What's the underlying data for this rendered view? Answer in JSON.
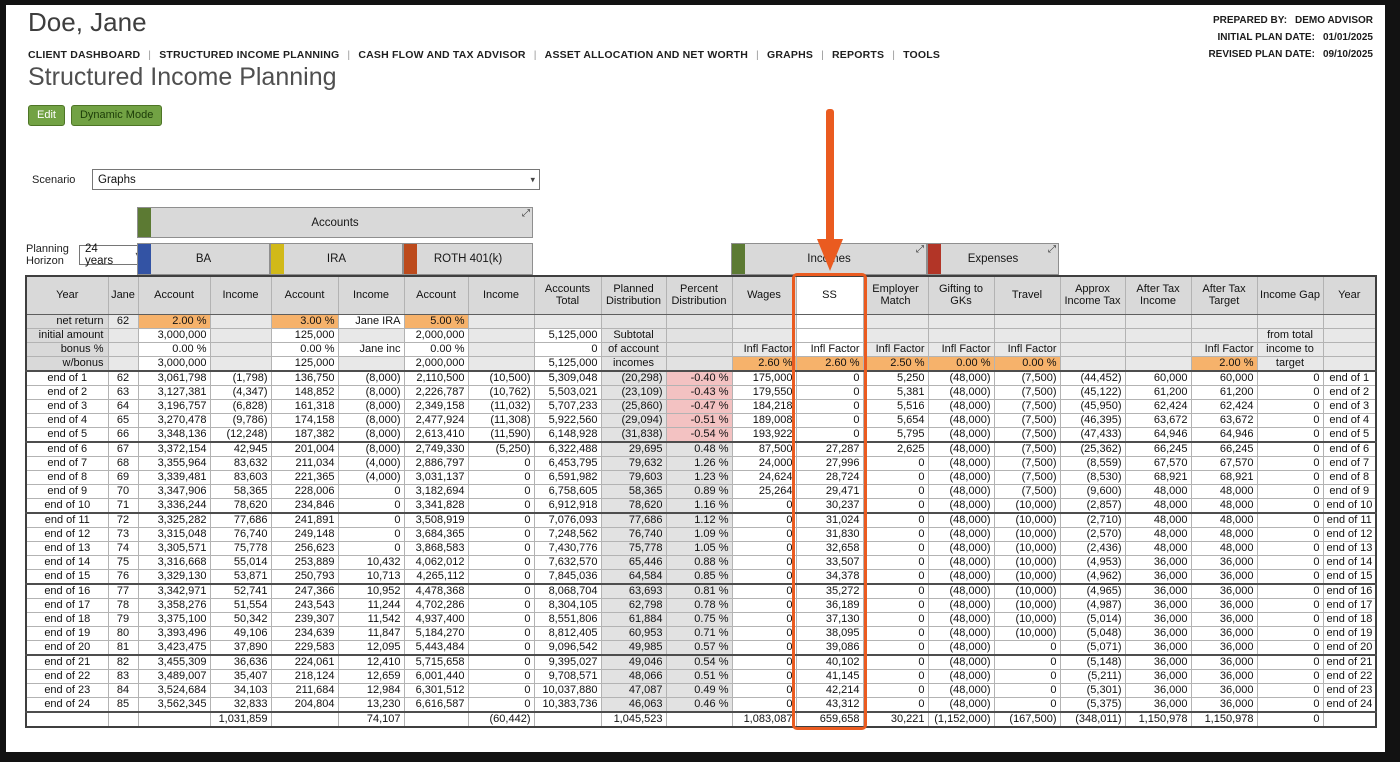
{
  "header": {
    "client_name": "Doe, Jane",
    "prepared_by_label": "PREPARED BY:",
    "prepared_by": "DEMO ADVISOR",
    "initial_plan_date_label": "INITIAL PLAN DATE:",
    "initial_plan_date": "01/01/2025",
    "revised_plan_date_label": "REVISED PLAN DATE:",
    "revised_plan_date": "09/10/2025"
  },
  "nav": {
    "items": [
      "CLIENT DASHBOARD",
      "STRUCTURED INCOME PLANNING",
      "CASH FLOW AND TAX ADVISOR",
      "ASSET ALLOCATION AND NET WORTH",
      "GRAPHS",
      "REPORTS",
      "TOOLS"
    ]
  },
  "page": {
    "title": "Structured Income Planning",
    "buttons": {
      "edit": "Edit",
      "dynamic_mode": "Dynamic Mode"
    },
    "scenario_label": "Scenario",
    "scenario_value": "Graphs",
    "planning_horizon_label": "Planning Horizon",
    "planning_horizon_value": "24 years"
  },
  "colors": {
    "accent_orange": "#ea5b20",
    "button_green": "#72a244",
    "group_green": "#5c7a33",
    "ba_blue": "#3353a4",
    "ira_yellow": "#d1b919",
    "roth_red": "#bc4a1c",
    "expenses_red": "#b23527",
    "infl_factor_cell_orange": "#f6b26b",
    "negative_percent_pink": "#f3c2c2"
  },
  "table": {
    "groups": {
      "accounts": "Accounts",
      "ba": "BA",
      "ira": "IRA",
      "roth": "ROTH 401(k)",
      "incomes": "Incomes",
      "expenses": "Expenses"
    },
    "columns": [
      "Year",
      "Jane",
      "Account",
      "Income",
      "Account",
      "Income",
      "Account",
      "Income",
      "Accounts Total",
      "Planned Distribution",
      "Percent Distribution",
      "Wages",
      "SS",
      "Employer Match",
      "Gifting to GKs",
      "Travel",
      "Approx Income Tax",
      "After Tax Income",
      "After Tax Target",
      "Income Gap",
      "Year"
    ],
    "meta_rows": [
      [
        "net return",
        "62",
        "2.00 %",
        "",
        "3.00 %",
        "Jane IRA",
        "5.00 %",
        "",
        "",
        "",
        "",
        "",
        "",
        "",
        "",
        "",
        "",
        "",
        "",
        "",
        ""
      ],
      [
        "initial amount",
        "",
        "3,000,000",
        "",
        "125,000",
        "",
        "2,000,000",
        "",
        "5,125,000",
        "Subtotal",
        "",
        "",
        "",
        "",
        "",
        "",
        "",
        "",
        "",
        "from total",
        ""
      ],
      [
        "bonus %",
        "",
        "0.00 %",
        "",
        "0.00 %",
        "Jane inc",
        "0.00 %",
        "",
        "0",
        "of account",
        "",
        "Infl Factor",
        "Infl Factor",
        "Infl Factor",
        "Infl Factor",
        "Infl Factor",
        "",
        "",
        "Infl Factor",
        "income to",
        ""
      ],
      [
        "w/bonus",
        "",
        "3,000,000",
        "",
        "125,000",
        "",
        "2,000,000",
        "",
        "5,125,000",
        "incomes",
        "",
        "2.60 %",
        "2.60 %",
        "2.50 %",
        "0.00 %",
        "0.00 %",
        "",
        "",
        "2.00 %",
        "target",
        ""
      ]
    ],
    "rows": [
      [
        "end of 1",
        "62",
        "3,061,798",
        "(1,798)",
        "136,750",
        "(8,000)",
        "2,110,500",
        "(10,500)",
        "5,309,048",
        "(20,298)",
        "-0.40 %",
        "175,000",
        "0",
        "5,250",
        "(48,000)",
        "(7,500)",
        "(44,452)",
        "60,000",
        "60,000",
        "0",
        "end of 1"
      ],
      [
        "end of 2",
        "63",
        "3,127,381",
        "(4,347)",
        "148,852",
        "(8,000)",
        "2,226,787",
        "(10,762)",
        "5,503,021",
        "(23,109)",
        "-0.43 %",
        "179,550",
        "0",
        "5,381",
        "(48,000)",
        "(7,500)",
        "(45,122)",
        "61,200",
        "61,200",
        "0",
        "end of 2"
      ],
      [
        "end of 3",
        "64",
        "3,196,757",
        "(6,828)",
        "161,318",
        "(8,000)",
        "2,349,158",
        "(11,032)",
        "5,707,233",
        "(25,860)",
        "-0.47 %",
        "184,218",
        "0",
        "5,516",
        "(48,000)",
        "(7,500)",
        "(45,950)",
        "62,424",
        "62,424",
        "0",
        "end of 3"
      ],
      [
        "end of 4",
        "65",
        "3,270,478",
        "(9,786)",
        "174,158",
        "(8,000)",
        "2,477,924",
        "(11,308)",
        "5,922,560",
        "(29,094)",
        "-0.51 %",
        "189,008",
        "0",
        "5,654",
        "(48,000)",
        "(7,500)",
        "(46,395)",
        "63,672",
        "63,672",
        "0",
        "end of 4"
      ],
      [
        "end of 5",
        "66",
        "3,348,136",
        "(12,248)",
        "187,382",
        "(8,000)",
        "2,613,410",
        "(11,590)",
        "6,148,928",
        "(31,838)",
        "-0.54 %",
        "193,922",
        "0",
        "5,795",
        "(48,000)",
        "(7,500)",
        "(47,433)",
        "64,946",
        "64,946",
        "0",
        "end of 5"
      ],
      [
        "end of 6",
        "67",
        "3,372,154",
        "42,945",
        "201,004",
        "(8,000)",
        "2,749,330",
        "(5,250)",
        "6,322,488",
        "29,695",
        "0.48 %",
        "87,500",
        "27,287",
        "2,625",
        "(48,000)",
        "(7,500)",
        "(25,362)",
        "66,245",
        "66,245",
        "0",
        "end of 6"
      ],
      [
        "end of 7",
        "68",
        "3,355,964",
        "83,632",
        "211,034",
        "(4,000)",
        "2,886,797",
        "0",
        "6,453,795",
        "79,632",
        "1.26 %",
        "24,000",
        "27,996",
        "0",
        "(48,000)",
        "(7,500)",
        "(8,559)",
        "67,570",
        "67,570",
        "0",
        "end of 7"
      ],
      [
        "end of 8",
        "69",
        "3,339,481",
        "83,603",
        "221,365",
        "(4,000)",
        "3,031,137",
        "0",
        "6,591,982",
        "79,603",
        "1.23 %",
        "24,624",
        "28,724",
        "0",
        "(48,000)",
        "(7,500)",
        "(8,530)",
        "68,921",
        "68,921",
        "0",
        "end of 8"
      ],
      [
        "end of 9",
        "70",
        "3,347,906",
        "58,365",
        "228,006",
        "0",
        "3,182,694",
        "0",
        "6,758,605",
        "58,365",
        "0.89 %",
        "25,264",
        "29,471",
        "0",
        "(48,000)",
        "(7,500)",
        "(9,600)",
        "48,000",
        "48,000",
        "0",
        "end of 9"
      ],
      [
        "end of 10",
        "71",
        "3,336,244",
        "78,620",
        "234,846",
        "0",
        "3,341,828",
        "0",
        "6,912,918",
        "78,620",
        "1.16 %",
        "0",
        "30,237",
        "0",
        "(48,000)",
        "(10,000)",
        "(2,857)",
        "48,000",
        "48,000",
        "0",
        "end of 10"
      ],
      [
        "end of 11",
        "72",
        "3,325,282",
        "77,686",
        "241,891",
        "0",
        "3,508,919",
        "0",
        "7,076,093",
        "77,686",
        "1.12 %",
        "0",
        "31,024",
        "0",
        "(48,000)",
        "(10,000)",
        "(2,710)",
        "48,000",
        "48,000",
        "0",
        "end of 11"
      ],
      [
        "end of 12",
        "73",
        "3,315,048",
        "76,740",
        "249,148",
        "0",
        "3,684,365",
        "0",
        "7,248,562",
        "76,740",
        "1.09 %",
        "0",
        "31,830",
        "0",
        "(48,000)",
        "(10,000)",
        "(2,570)",
        "48,000",
        "48,000",
        "0",
        "end of 12"
      ],
      [
        "end of 13",
        "74",
        "3,305,571",
        "75,778",
        "256,623",
        "0",
        "3,868,583",
        "0",
        "7,430,776",
        "75,778",
        "1.05 %",
        "0",
        "32,658",
        "0",
        "(48,000)",
        "(10,000)",
        "(2,436)",
        "48,000",
        "48,000",
        "0",
        "end of 13"
      ],
      [
        "end of 14",
        "75",
        "3,316,668",
        "55,014",
        "253,889",
        "10,432",
        "4,062,012",
        "0",
        "7,632,570",
        "65,446",
        "0.88 %",
        "0",
        "33,507",
        "0",
        "(48,000)",
        "(10,000)",
        "(4,953)",
        "36,000",
        "36,000",
        "0",
        "end of 14"
      ],
      [
        "end of 15",
        "76",
        "3,329,130",
        "53,871",
        "250,793",
        "10,713",
        "4,265,112",
        "0",
        "7,845,036",
        "64,584",
        "0.85 %",
        "0",
        "34,378",
        "0",
        "(48,000)",
        "(10,000)",
        "(4,962)",
        "36,000",
        "36,000",
        "0",
        "end of 15"
      ],
      [
        "end of 16",
        "77",
        "3,342,971",
        "52,741",
        "247,366",
        "10,952",
        "4,478,368",
        "0",
        "8,068,704",
        "63,693",
        "0.81 %",
        "0",
        "35,272",
        "0",
        "(48,000)",
        "(10,000)",
        "(4,965)",
        "36,000",
        "36,000",
        "0",
        "end of 16"
      ],
      [
        "end of 17",
        "78",
        "3,358,276",
        "51,554",
        "243,543",
        "11,244",
        "4,702,286",
        "0",
        "8,304,105",
        "62,798",
        "0.78 %",
        "0",
        "36,189",
        "0",
        "(48,000)",
        "(10,000)",
        "(4,987)",
        "36,000",
        "36,000",
        "0",
        "end of 17"
      ],
      [
        "end of 18",
        "79",
        "3,375,100",
        "50,342",
        "239,307",
        "11,542",
        "4,937,400",
        "0",
        "8,551,806",
        "61,884",
        "0.75 %",
        "0",
        "37,130",
        "0",
        "(48,000)",
        "(10,000)",
        "(5,014)",
        "36,000",
        "36,000",
        "0",
        "end of 18"
      ],
      [
        "end of 19",
        "80",
        "3,393,496",
        "49,106",
        "234,639",
        "11,847",
        "5,184,270",
        "0",
        "8,812,405",
        "60,953",
        "0.71 %",
        "0",
        "38,095",
        "0",
        "(48,000)",
        "(10,000)",
        "(5,048)",
        "36,000",
        "36,000",
        "0",
        "end of 19"
      ],
      [
        "end of 20",
        "81",
        "3,423,475",
        "37,890",
        "229,583",
        "12,095",
        "5,443,484",
        "0",
        "9,096,542",
        "49,985",
        "0.57 %",
        "0",
        "39,086",
        "0",
        "(48,000)",
        "0",
        "(5,071)",
        "36,000",
        "36,000",
        "0",
        "end of 20"
      ],
      [
        "end of 21",
        "82",
        "3,455,309",
        "36,636",
        "224,061",
        "12,410",
        "5,715,658",
        "0",
        "9,395,027",
        "49,046",
        "0.54 %",
        "0",
        "40,102",
        "0",
        "(48,000)",
        "0",
        "(5,148)",
        "36,000",
        "36,000",
        "0",
        "end of 21"
      ],
      [
        "end of 22",
        "83",
        "3,489,007",
        "35,407",
        "218,124",
        "12,659",
        "6,001,440",
        "0",
        "9,708,571",
        "48,066",
        "0.51 %",
        "0",
        "41,145",
        "0",
        "(48,000)",
        "0",
        "(5,211)",
        "36,000",
        "36,000",
        "0",
        "end of 22"
      ],
      [
        "end of 23",
        "84",
        "3,524,684",
        "34,103",
        "211,684",
        "12,984",
        "6,301,512",
        "0",
        "10,037,880",
        "47,087",
        "0.49 %",
        "0",
        "42,214",
        "0",
        "(48,000)",
        "0",
        "(5,301)",
        "36,000",
        "36,000",
        "0",
        "end of 23"
      ],
      [
        "end of 24",
        "85",
        "3,562,345",
        "32,833",
        "204,804",
        "13,230",
        "6,616,587",
        "0",
        "10,383,736",
        "46,063",
        "0.46 %",
        "0",
        "43,312",
        "0",
        "(48,000)",
        "0",
        "(5,375)",
        "36,000",
        "36,000",
        "0",
        "end of 24"
      ]
    ],
    "totals": [
      "",
      "",
      "",
      "1,031,859",
      "",
      "74,107",
      "",
      "(60,442)",
      "",
      "1,045,523",
      "",
      "1,083,087",
      "659,658",
      "30,221",
      "(1,152,000)",
      "(167,500)",
      "(348,011)",
      "1,150,978",
      "1,150,978",
      "0",
      ""
    ]
  }
}
